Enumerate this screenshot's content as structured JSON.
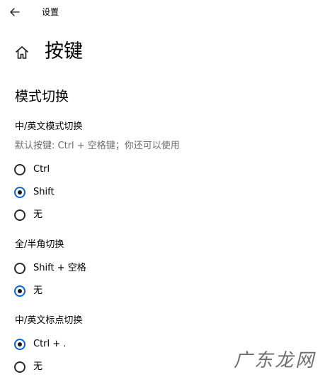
{
  "window": {
    "title": "设置"
  },
  "page": {
    "title": "按键"
  },
  "section": {
    "title": "模式切换"
  },
  "groups": [
    {
      "label": "中/英文模式切换",
      "description": "默认按键: Ctrl + 空格键；你还可以使用",
      "options": [
        {
          "label": "Ctrl",
          "selected": false
        },
        {
          "label": "Shift",
          "selected": true
        },
        {
          "label": "无",
          "selected": false
        }
      ]
    },
    {
      "label": "全/半角切换",
      "options": [
        {
          "label": "Shift + 空格",
          "selected": false
        },
        {
          "label": "无",
          "selected": true
        }
      ]
    },
    {
      "label": "中/英文标点切换",
      "options": [
        {
          "label": "Ctrl + .",
          "selected": true
        },
        {
          "label": "无",
          "selected": false
        }
      ]
    }
  ],
  "watermark": {
    "text": "广东龙网"
  },
  "colors": {
    "accent": "#0a64d1",
    "text": "#000000",
    "secondary_text": "#6d6d6d"
  },
  "icons": {
    "back": "back-arrow-icon",
    "home": "home-icon"
  }
}
